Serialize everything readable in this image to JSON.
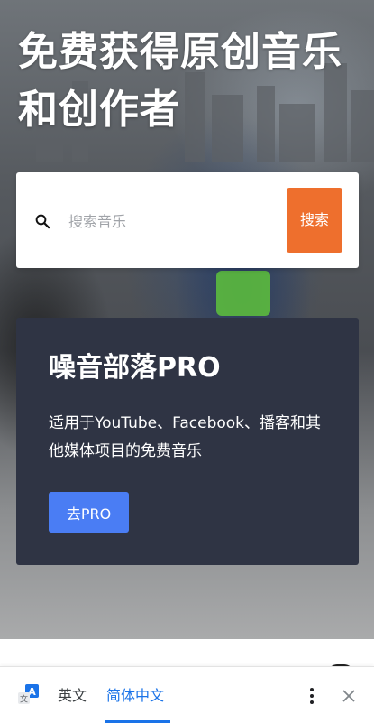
{
  "hero": {
    "title": "免费获得原创音乐和创作者"
  },
  "search": {
    "placeholder": "搜索音乐",
    "button_label": "搜索",
    "icon": "search-icon"
  },
  "pro_card": {
    "title": "噪音部落PRO",
    "description": "适用于YouTube、Facebook、播客和其他媒体项目的免费音乐",
    "button_label": "去PRO"
  },
  "translate_bar": {
    "icon": "translate-icon",
    "languages": [
      "英文",
      "简体中文"
    ],
    "selected": "简体中文",
    "more_icon": "more-vert-icon",
    "close_icon": "close-icon"
  },
  "colors": {
    "search_button": "#ee6f2d",
    "card_background": "#2f3444",
    "pro_button": "#4a7df4",
    "translate_accent": "#1a73e8"
  }
}
